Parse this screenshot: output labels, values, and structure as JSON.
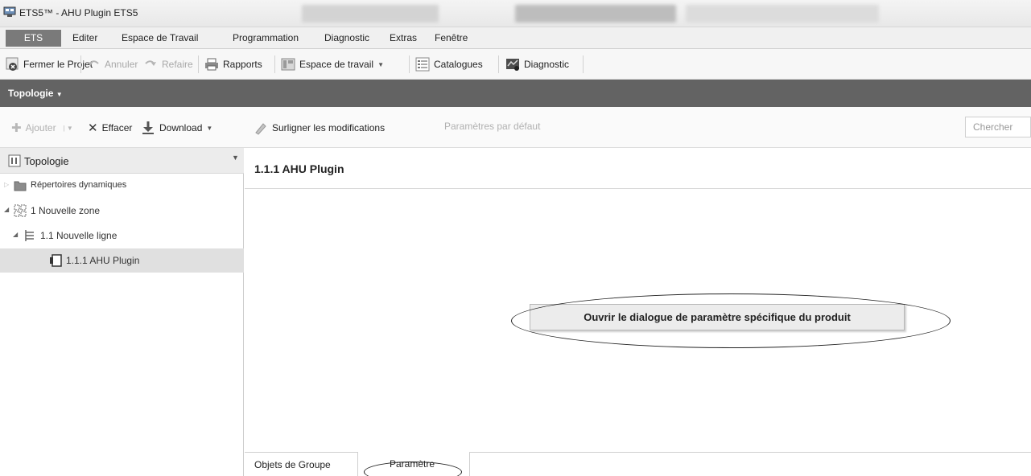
{
  "window": {
    "title": "ETS5™ - AHU Plugin ETS5"
  },
  "menubar": {
    "app_tab": "ETS",
    "items": [
      "Editer",
      "Espace de Travail",
      "Programmation",
      "Diagnostic",
      "Extras",
      "Fenêtre"
    ]
  },
  "toolbar": {
    "close_project": "Fermer le Projet",
    "undo": "Annuler",
    "redo": "Refaire",
    "reports": "Rapports",
    "workspace": "Espace de travail",
    "catalogs": "Catalogues",
    "diagnostic": "Diagnostic"
  },
  "panel": {
    "title": "Topologie"
  },
  "actions": {
    "add": "Ajouter",
    "delete": "Effacer",
    "download": "Download",
    "highlight": "Surligner les modifications",
    "defaults": "Paramètres par défaut",
    "search_placeholder": "Chercher"
  },
  "tree": {
    "header": "Topologie",
    "items": [
      {
        "label": "Répertoires dynamiques"
      },
      {
        "label": "1 Nouvelle zone"
      },
      {
        "label": "1.1 Nouvelle ligne"
      },
      {
        "label": "1.1.1 AHU Plugin"
      }
    ]
  },
  "main": {
    "title": "1.1.1 AHU Plugin",
    "open_dialog_button": "Ouvrir le dialogue de paramètre spécifique du produit",
    "tabs": [
      "Objets de Groupe",
      "Paramètre"
    ]
  },
  "colors": {
    "ets_tab": "#7a7a7a",
    "panel_bar": "#636363",
    "selected_row": "#e0e0e0"
  }
}
